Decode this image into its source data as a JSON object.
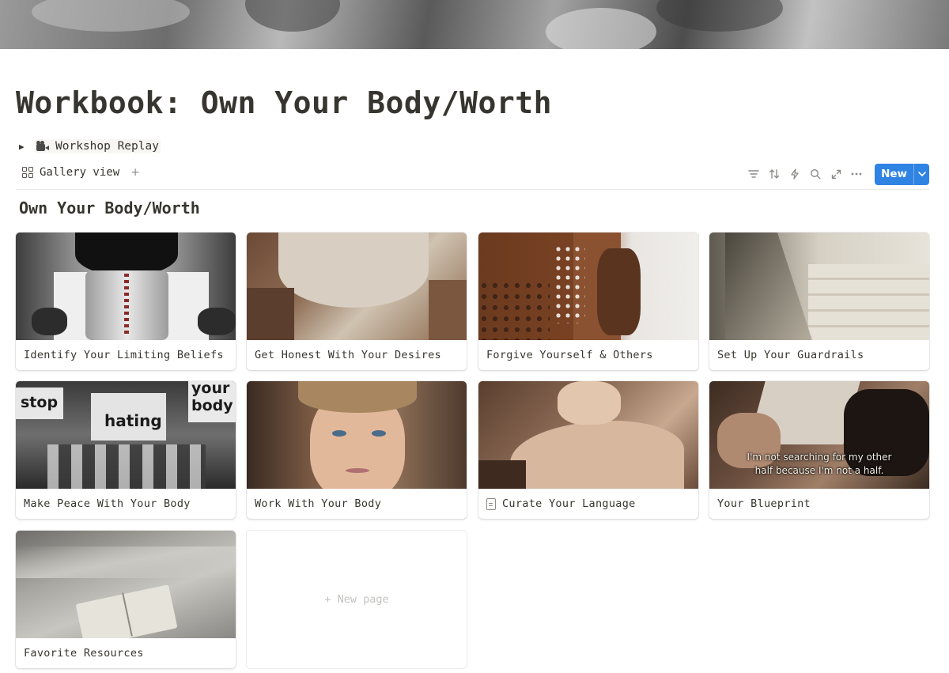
{
  "page": {
    "title": "Workbook: Own Your Body/Worth"
  },
  "toggle": {
    "label": "Workshop Replay",
    "icon": "movie-camera-icon"
  },
  "view_bar": {
    "tab_label": "Gallery view",
    "add_view": "+",
    "tools": [
      "filter-icon",
      "sort-icon",
      "automation-icon",
      "search-icon",
      "expand-icon",
      "more-icon"
    ],
    "new_button": "New",
    "accent": "#2f83e2"
  },
  "gallery": {
    "title": "Own Your Body/Worth",
    "cards": [
      {
        "title": "Identify Your Limiting Beliefs"
      },
      {
        "title": "Get Honest With Your Desires"
      },
      {
        "title": "Forgive Yourself & Others"
      },
      {
        "title": "Set Up Your Guardrails"
      },
      {
        "title": "Make Peace With Your Body",
        "image_text": [
          "stop",
          "hating",
          "your",
          "body"
        ]
      },
      {
        "title": "Work With Your Body"
      },
      {
        "title": "Curate Your Language",
        "icon": "page-icon"
      },
      {
        "title": "Your Blueprint",
        "image_text": [
          "I'm not searching for my other",
          "half because I'm not a half."
        ]
      },
      {
        "title": "Favorite Resources"
      }
    ],
    "new_page": "+ New page"
  }
}
